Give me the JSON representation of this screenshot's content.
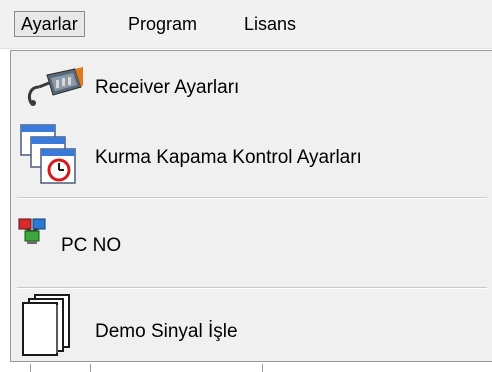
{
  "menubar": {
    "items": [
      {
        "label": "Ayarlar",
        "state": "open"
      },
      {
        "label": "Program"
      },
      {
        "label": "Lisans"
      }
    ]
  },
  "dropdown": {
    "items": [
      {
        "label": "Receiver Ayarları",
        "icon": "receiver-device-icon"
      },
      {
        "label": "Kurma Kapama Kontrol Ayarları",
        "icon": "windows-clock-icon"
      },
      {
        "label": "PC NO",
        "icon": "pc-network-icon"
      },
      {
        "label": "Demo Sinyal İşle",
        "icon": "stacked-pages-icon"
      }
    ]
  },
  "colors": {
    "menu_background": "#f0f0f0",
    "menubar_background": "#f1f1f1",
    "open_item_border": "#8a8a8a",
    "separator": "#c8c8c8"
  }
}
